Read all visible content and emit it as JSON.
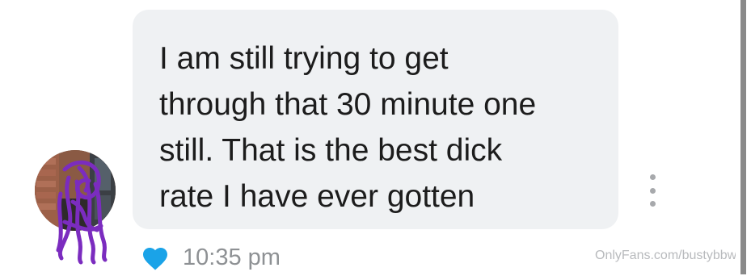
{
  "message": {
    "text": "I am still trying to get\nthrough that 30 minute one\nstill. That is the best dick\nrate I have ever gotten",
    "timestamp": "10:35 pm",
    "liked": true,
    "heart_color": "#1aa3e8"
  },
  "sender": {
    "avatar_icon": "avatar-photo-scribbled",
    "scribble_color": "#7b2cbf"
  },
  "actions": {
    "more_icon": "vertical-dots-icon"
  },
  "watermark": {
    "text": "OnlyFans.com/bustybbwkate"
  },
  "colors": {
    "bubble_bg": "#eff1f3",
    "text": "#1c1c1c",
    "timestamp": "#8e9194"
  }
}
